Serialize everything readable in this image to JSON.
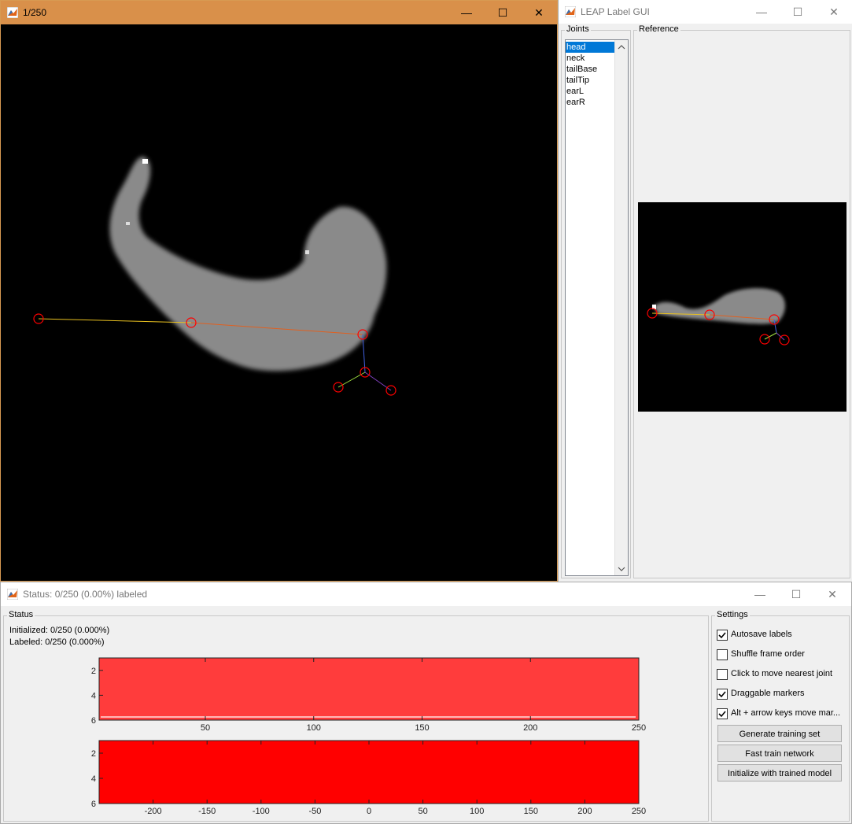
{
  "frame_window": {
    "title": "1/250",
    "minimize": "—",
    "maximize": "☐",
    "close": "✕"
  },
  "leap_window": {
    "title": "LEAP Label GUI",
    "minimize": "—",
    "maximize": "☐",
    "close": "✕",
    "joints_label": "Joints",
    "joints": [
      "head",
      "neck",
      "tailBase",
      "tailTip",
      "earL",
      "earR"
    ],
    "selected_joint": "head",
    "reference_label": "Reference"
  },
  "status_window": {
    "title": "Status: 0/250 (0.00%) labeled",
    "minimize": "—",
    "maximize": "☐",
    "close": "✕",
    "status_label": "Status",
    "initialized": "Initialized: 0/250 (0.000%)",
    "labeled": "Labeled: 0/250 (0.000%)",
    "settings_label": "Settings",
    "settings": [
      {
        "label": "Autosave labels",
        "checked": true
      },
      {
        "label": "Shuffle frame order",
        "checked": false
      },
      {
        "label": "Click to move nearest joint",
        "checked": false
      },
      {
        "label": "Draggable markers",
        "checked": true
      },
      {
        "label": "Alt + arrow keys move mar...",
        "checked": true
      }
    ],
    "buttons": [
      "Generate training set",
      "Fast train network",
      "Initialize with trained model"
    ]
  },
  "chart_data": [
    {
      "type": "heatmap",
      "title": "",
      "xlabel": "",
      "ylabel": "",
      "xlim": [
        1,
        250
      ],
      "ylim": [
        6,
        1
      ],
      "xticks": [
        "50",
        "100",
        "150",
        "200",
        "250"
      ],
      "yticks": [
        "2",
        "4",
        "6"
      ],
      "fill_color": "#ff3c3c",
      "annotation_line_at_y": 6
    },
    {
      "type": "heatmap",
      "title": "",
      "xlabel": "",
      "ylabel": "",
      "xlim": [
        -250,
        250
      ],
      "ylim": [
        6,
        1
      ],
      "xticks": [
        "-200",
        "-150",
        "-100",
        "-50",
        "0",
        "50",
        "100",
        "150",
        "200",
        "250"
      ],
      "yticks": [
        "2",
        "4",
        "6"
      ],
      "fill_color": "#ff0000"
    }
  ],
  "colors": {
    "frame_titlebar": "#d9904a",
    "marker": "#ff0000",
    "selection": "#0078d7"
  }
}
